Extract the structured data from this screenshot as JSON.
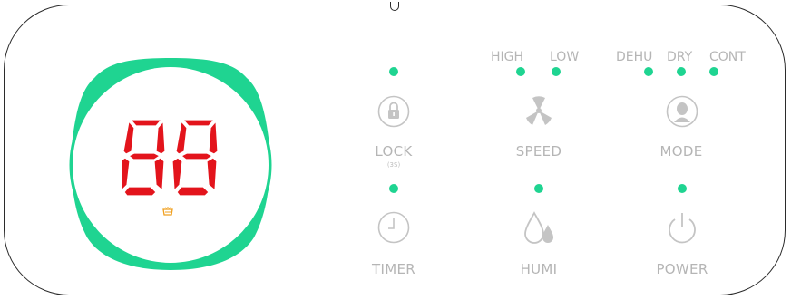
{
  "display": {
    "digits": "88",
    "digit_color": "#e3141c",
    "ring_color": "#1fd491",
    "indicator_icon": "water-tank-icon",
    "indicator_color": "#f0a020"
  },
  "indicators": {
    "fan_speed": [
      "HIGH",
      "LOW"
    ],
    "mode": [
      "DEHU",
      "DRY",
      "CONT"
    ]
  },
  "buttons": {
    "lock": {
      "label": "LOCK",
      "sub_label": "(3S)",
      "icon": "lock-icon"
    },
    "speed": {
      "label": "SPEED",
      "icon": "fan-icon"
    },
    "mode": {
      "label": "MODE",
      "icon": "person-icon"
    },
    "timer": {
      "label": "TIMER",
      "icon": "clock-icon"
    },
    "humi": {
      "label": "HUMI",
      "icon": "droplets-icon"
    },
    "power": {
      "label": "POWER",
      "icon": "power-icon"
    }
  },
  "colors": {
    "led": "#1fd491",
    "label": "#b5b5b5",
    "outline": "#2b2b2b"
  }
}
